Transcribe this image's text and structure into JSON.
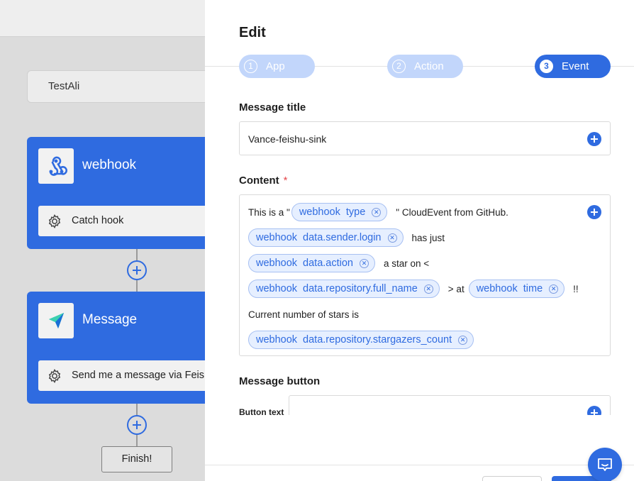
{
  "canvas": {
    "flow_name": "TestAli",
    "nodes": [
      {
        "title": "webhook",
        "icon": "webhook-icon",
        "subtitle": "Catch hook"
      },
      {
        "title": "Message",
        "icon": "feishu-icon",
        "subtitle": "Send me a message via Feishu"
      }
    ],
    "finish_label": "Finish!"
  },
  "drawer": {
    "title": "Edit",
    "steps": [
      {
        "num": "1",
        "label": "App",
        "state": "done"
      },
      {
        "num": "2",
        "label": "Action",
        "state": "done"
      },
      {
        "num": "3",
        "label": "Event",
        "state": "active"
      }
    ],
    "message_title": {
      "label": "Message title",
      "value": "Vance-feishu-sink"
    },
    "content": {
      "label": "Content",
      "required_mark": "*",
      "lines": [
        {
          "text_before": "This is a \"",
          "chip": {
            "source": "webhook",
            "field": "type"
          },
          "text_after": "\" CloudEvent from GitHub."
        },
        {
          "chip": {
            "source": "webhook",
            "field": "data.sender.login"
          },
          "text_after": "has just"
        },
        {
          "chip": {
            "source": "webhook",
            "field": "data.action"
          },
          "text_after": "a star on <"
        },
        {
          "chip": {
            "source": "webhook",
            "field": "data.repository.full_name"
          },
          "text_after": "> at",
          "chip2": {
            "source": "webhook",
            "field": "time"
          },
          "text_after2": "!!"
        },
        {
          "text_before": "Current number of stars is"
        },
        {
          "chip": {
            "source": "webhook",
            "field": "data.repository.stargazers_count"
          }
        }
      ]
    },
    "message_button": {
      "label": "Message button",
      "button_text_label": "Button text"
    }
  },
  "colors": {
    "accent": "#2f6be0",
    "accent_light": "#c2d6fb",
    "chip_bg": "#e6efff",
    "required": "#e5484d"
  }
}
